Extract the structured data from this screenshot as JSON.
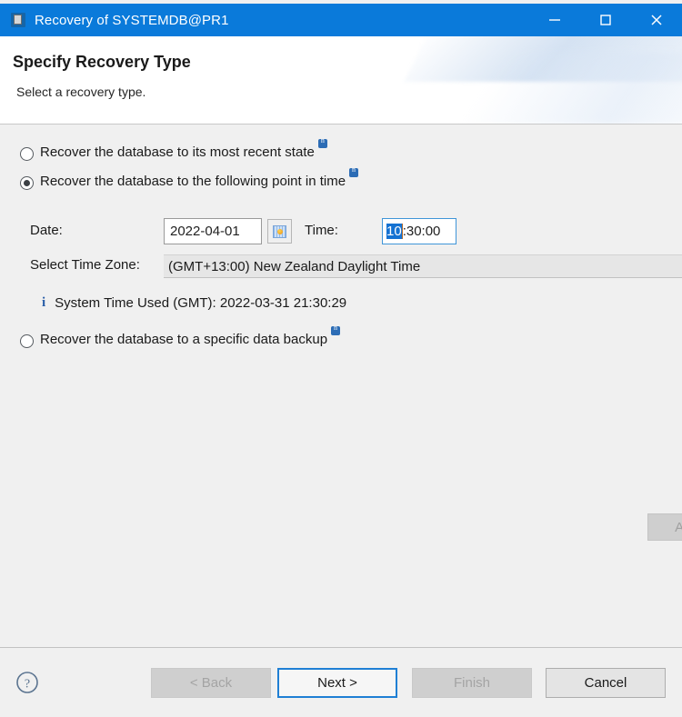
{
  "window": {
    "title": "Recovery of SYSTEMDB@PR1",
    "icon": "database-window-icon",
    "controls": {
      "minimize": "minimize-icon",
      "maximize": "maximize-icon",
      "close": "close-icon"
    }
  },
  "header": {
    "title": "Specify Recovery Type",
    "subtitle": "Select a recovery type."
  },
  "options": [
    {
      "label": "Recover the database to its most recent state",
      "checked": false,
      "badge": "n"
    },
    {
      "label": "Recover the database to the following point in time",
      "checked": true,
      "badge": "n"
    },
    {
      "label": "Recover the database to a specific data backup",
      "checked": false,
      "badge": "n"
    }
  ],
  "point_in_time": {
    "date_label": "Date:",
    "date_value": "2022-04-01",
    "date_picker_icon": "calendar-icon",
    "time_label": "Time:",
    "time_value_selected": "10",
    "time_value_rest": ":30:00",
    "timezone_label": "Select Time Zone:",
    "timezone_value": "(GMT+13:00) New Zealand Daylight Time",
    "system_time_icon": "info-icon",
    "system_time_text": "System Time Used (GMT): 2022-03-31 21:30:29"
  },
  "advanced_button": {
    "label": "Adv",
    "enabled": false
  },
  "footer": {
    "help_icon": "help-circle-icon",
    "buttons": {
      "back": "< Back",
      "next": "Next >",
      "finish": "Finish",
      "cancel": "Cancel"
    }
  },
  "colors": {
    "titlebar": "#0a7ada",
    "accent": "#1572d2",
    "body_bg": "#f0f0f0",
    "badge": "#2c6cb5",
    "info": "#2b5fa8"
  }
}
